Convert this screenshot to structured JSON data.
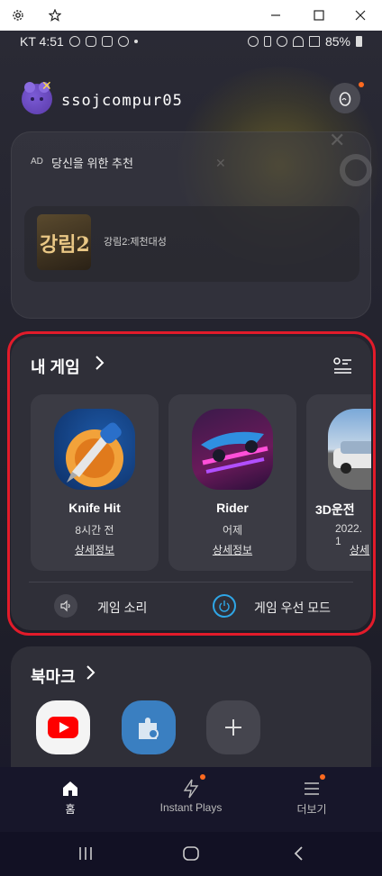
{
  "status_bar": {
    "carrier_time": "KT 4:51",
    "battery": "85%"
  },
  "header": {
    "username": "ssojcompur05"
  },
  "recommend": {
    "ad_badge": "AD",
    "title": "당신을 위한 추천",
    "item_thumb_text": "강림2",
    "item_name": "강림2:제천대성"
  },
  "my_games": {
    "title": "내 게임",
    "games": [
      {
        "name": "Knife Hit",
        "time": "8시간 전",
        "detail": "상세정보"
      },
      {
        "name": "Rider",
        "time": "어제",
        "detail": "상세정보"
      },
      {
        "name": "3D운전",
        "time": "2022. 1",
        "detail": "상세"
      }
    ],
    "sound_label": "게임 소리",
    "priority_label": "게임 우선 모드",
    "priority_color": "#2fa6e6"
  },
  "bookmarks": {
    "title": "북마크"
  },
  "bottom_nav": {
    "home": "홈",
    "instant": "Instant Plays",
    "more": "더보기"
  },
  "colors": {
    "highlight_outline": "#e21b2a",
    "notification_dot": "#ff6a1f"
  }
}
